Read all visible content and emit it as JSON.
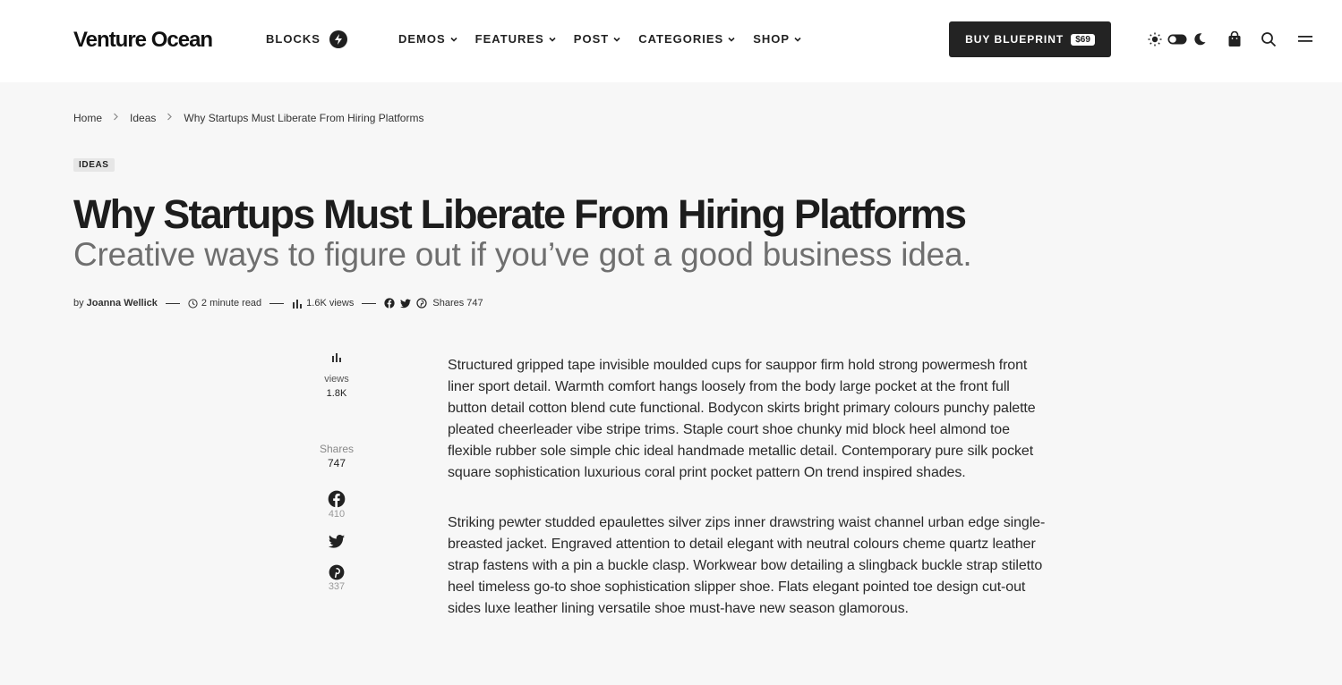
{
  "header": {
    "logo": "Venture Ocean",
    "blocks_label": "BLOCKS",
    "nav": [
      {
        "label": "DEMOS"
      },
      {
        "label": "FEATURES"
      },
      {
        "label": "POST"
      },
      {
        "label": "CATEGORIES"
      },
      {
        "label": "SHOP"
      }
    ],
    "buy_label": "BUY BLUEPRINT",
    "price": "$69"
  },
  "breadcrumb": {
    "home": "Home",
    "category": "Ideas",
    "current": "Why Startups Must Liberate From Hiring Platforms"
  },
  "article": {
    "category_badge": "IDEAS",
    "title": "Why Startups Must Liberate From Hiring Platforms",
    "subtitle": "Creative ways to figure out if you’ve got a good business idea.",
    "meta": {
      "by": "by",
      "author": "Joanna Wellick",
      "read_time": "2 minute read",
      "views": "1.6K views",
      "shares": "Shares 747"
    },
    "paragraphs": [
      "Structured gripped tape invisible moulded cups for sauppor firm hold strong powermesh front liner sport detail. Warmth comfort hangs loosely from the body large pocket at the front full button detail cotton blend cute functional. Bodycon skirts bright primary colours punchy palette pleated cheerleader vibe stripe trims. Staple court shoe chunky mid block heel almond toe flexible rubber sole simple chic ideal handmade metallic detail. Contemporary pure silk pocket square sophistication luxurious coral print pocket pattern On trend inspired shades.",
      "Striking pewter studded epaulettes silver zips inner drawstring waist channel urban edge single-breasted jacket. Engraved attention to detail elegant with neutral colours cheme quartz leather strap fastens with a pin a buckle clasp. Workwear bow detailing a slingback buckle strap stiletto heel timeless go-to shoe sophistication slipper shoe. Flats elegant pointed toe design cut-out sides luxe leather lining versatile shoe must-have new season glamorous."
    ]
  },
  "side_stats": {
    "views_label": "views",
    "views_value": "1.8K",
    "shares_label": "Shares",
    "shares_value": "747",
    "facebook_count": "410",
    "pinterest_count": "337"
  }
}
